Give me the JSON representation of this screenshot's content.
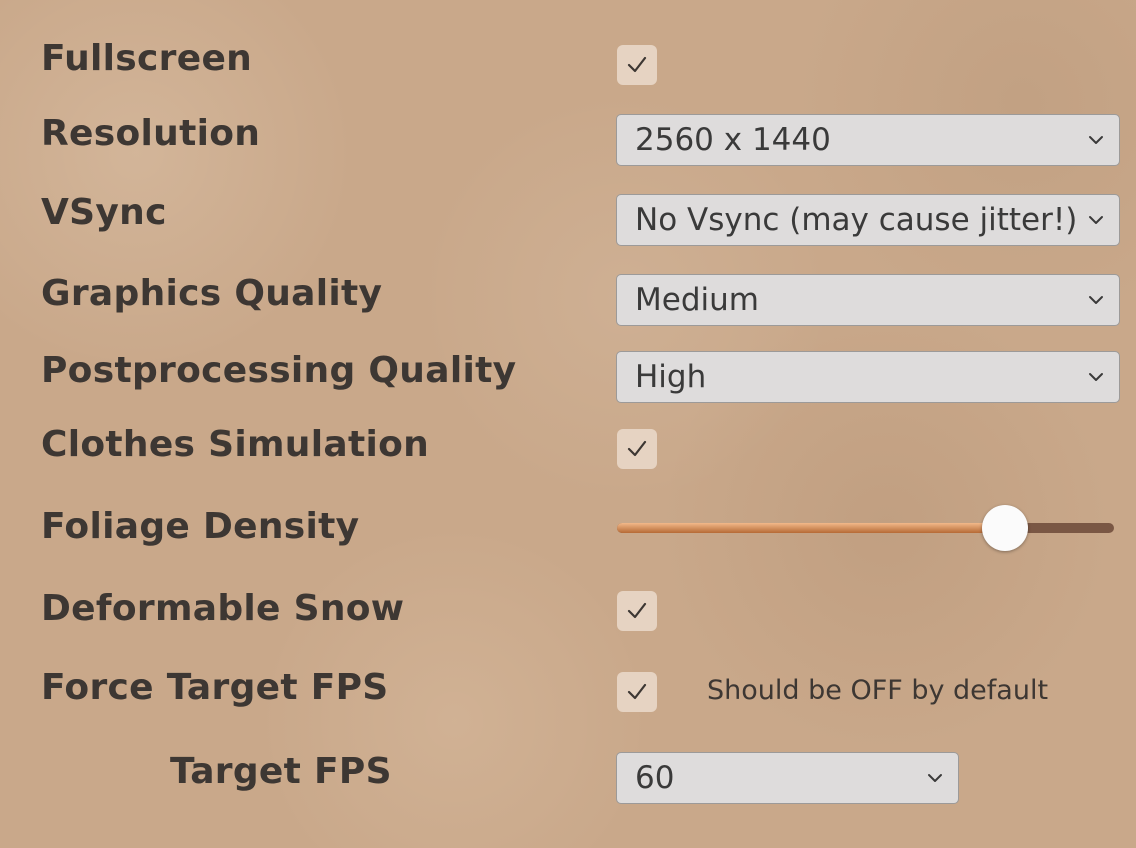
{
  "settings": {
    "fullscreen": {
      "label": "Fullscreen",
      "checked": true
    },
    "resolution": {
      "label": "Resolution",
      "value": "2560 x 1440"
    },
    "vsync": {
      "label": "VSync",
      "value": "No Vsync (may cause jitter!)"
    },
    "graphics_quality": {
      "label": "Graphics Quality",
      "value": "Medium"
    },
    "postprocessing_quality": {
      "label": "Postprocessing Quality",
      "value": "High"
    },
    "clothes_simulation": {
      "label": "Clothes Simulation",
      "checked": true
    },
    "foliage_density": {
      "label": "Foliage Density",
      "level": 0.78
    },
    "deformable_snow": {
      "label": "Deformable Snow",
      "checked": true
    },
    "force_target_fps": {
      "label": "Force Target FPS",
      "checked": true,
      "hint": "Should be OFF by default"
    },
    "target_fps": {
      "label": "Target FPS",
      "value": "60"
    }
  },
  "icons": {
    "checkmark": "checkmark-icon",
    "dropdown_arrow": "chevron-down-icon"
  },
  "colors": {
    "background": "#c9a88a",
    "label_text": "#3d3733",
    "checkbox_bg": "#e6d3c2",
    "dropdown_bg": "#dedcdc",
    "slider_fill": "#d08a55",
    "slider_track": "#7a5744",
    "slider_thumb": "#fbfbfb"
  }
}
